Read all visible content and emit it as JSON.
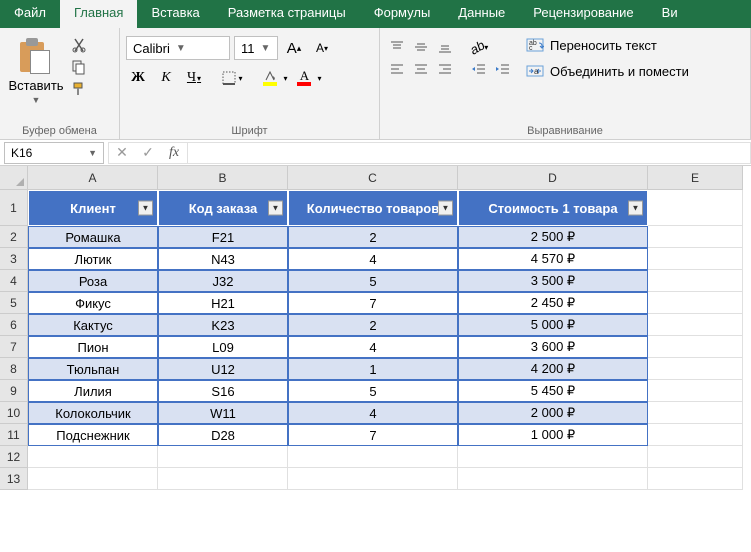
{
  "tabs": [
    "Файл",
    "Главная",
    "Вставка",
    "Разметка страницы",
    "Формулы",
    "Данные",
    "Рецензирование",
    "Ви"
  ],
  "active_tab": 1,
  "ribbon": {
    "clipboard": {
      "paste": "Вставить",
      "label": "Буфер обмена"
    },
    "font": {
      "name": "Calibri",
      "size": "11",
      "bold": "Ж",
      "italic": "К",
      "underline": "Ч",
      "increase": "A",
      "decrease": "A",
      "label": "Шрифт"
    },
    "alignment": {
      "wrap": "Переносить текст",
      "merge": "Объединить и помести",
      "label": "Выравнивание"
    }
  },
  "name_box": "K16",
  "formula": "",
  "columns": [
    "A",
    "B",
    "C",
    "D",
    "E"
  ],
  "first_row_num": 1,
  "table": {
    "headers": [
      "Клиент",
      "Код заказа",
      "Количество товаров",
      "Стоимость 1 товара"
    ],
    "rows": [
      [
        "Ромашка",
        "F21",
        "2",
        "2 500 ₽"
      ],
      [
        "Лютик",
        "N43",
        "4",
        "4 570 ₽"
      ],
      [
        "Роза",
        "J32",
        "5",
        "3 500 ₽"
      ],
      [
        "Фикус",
        "H21",
        "7",
        "2 450 ₽"
      ],
      [
        "Кактус",
        "K23",
        "2",
        "5 000 ₽"
      ],
      [
        "Пион",
        "L09",
        "4",
        "3 600 ₽"
      ],
      [
        "Тюльпан",
        "U12",
        "1",
        "4 200 ₽"
      ],
      [
        "Лилия",
        "S16",
        "5",
        "5 450 ₽"
      ],
      [
        "Колокольчик",
        "W11",
        "4",
        "2 000 ₽"
      ],
      [
        "Подснежник",
        "D28",
        "7",
        "1 000 ₽"
      ]
    ]
  }
}
